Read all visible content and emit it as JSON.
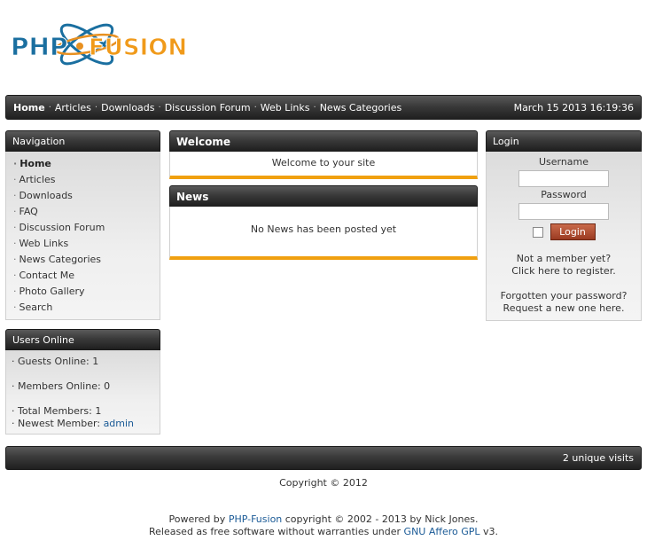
{
  "logo": {
    "text_left": "PHP",
    "text_right": "FUSION",
    "icon": "php-fusion-logo"
  },
  "topnav": {
    "links": [
      "Home",
      "Articles",
      "Downloads",
      "Discussion Forum",
      "Web Links",
      "News Categories"
    ],
    "clock": "March 15 2013 16:19:36"
  },
  "navigation": {
    "title": "Navigation",
    "items": [
      "Home",
      "Articles",
      "Downloads",
      "FAQ",
      "Discussion Forum",
      "Web Links",
      "News Categories",
      "Contact Me",
      "Photo Gallery",
      "Search"
    ]
  },
  "users_online": {
    "title": "Users Online",
    "guests": "Guests Online: 1",
    "members": "Members Online: 0",
    "total": "Total Members: 1",
    "newest_label": "Newest Member: ",
    "newest_user": "admin"
  },
  "welcome": {
    "title": "Welcome",
    "text": "Welcome to your site"
  },
  "news": {
    "title": "News",
    "text": "No News has been posted yet"
  },
  "login": {
    "title": "Login",
    "username_label": "Username",
    "password_label": "Password",
    "username_value": "",
    "password_value": "",
    "button": "Login",
    "not_member": "Not a member yet?",
    "register": "Click here to register.",
    "forgot": "Forgotten your password?",
    "request": "Request a new one here."
  },
  "bottombar": {
    "visits": "2 unique visits"
  },
  "copyright": "Copyright © 2012",
  "footer": {
    "powered_prefix": "Powered by ",
    "powered_link": "PHP-Fusion",
    "powered_suffix": " copyright © 2002 - 2013 by Nick Jones.",
    "license_prefix": "Released as free software without warranties under ",
    "license_link": "GNU Affero GPL",
    "license_suffix": " v3."
  },
  "colors": {
    "accent": "#f0a010",
    "bar_dark": "#2a2a2a",
    "link": "#1a5a96",
    "login_button": "#b04e30"
  }
}
